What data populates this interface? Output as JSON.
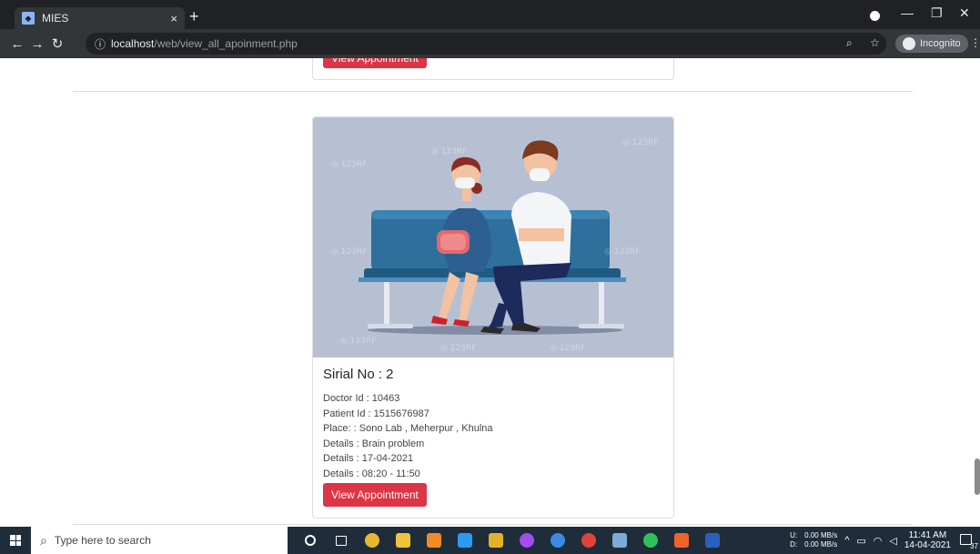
{
  "browser": {
    "tab_title": "MIES",
    "tab_close": "×",
    "new_tab": "+",
    "url_host": "localhost",
    "url_path": "/web/view_all_apoinment.php",
    "incognito_label": "Incognito"
  },
  "cards": {
    "previous": {
      "button": "View Appointment"
    },
    "current": {
      "title": "Sirial No : 2",
      "doctor_id": "Doctor Id : 10463",
      "patient_id": "Patient Id : 1515676987",
      "place": "Place: : Sono Lab , Meherpur , Khulna",
      "details_problem": "Details : Brain problem",
      "details_date": "Details : 17-04-2021",
      "details_time": "Details : 08:20 - 11:50",
      "button": "View Appointment",
      "watermark": "123RF"
    }
  },
  "taskbar": {
    "search_placeholder": "Type here to search",
    "net_up": "0.00 MB/s",
    "net_down": "0.00 MB/s",
    "net_up_label": "U:",
    "net_down_label": "D:",
    "time": "11:41 AM",
    "date": "14-04-2021",
    "notif_count": "37"
  },
  "colors": {
    "accent_red": "#dc3545",
    "image_bg": "#b7c0d3",
    "chrome_dark": "#202124"
  }
}
